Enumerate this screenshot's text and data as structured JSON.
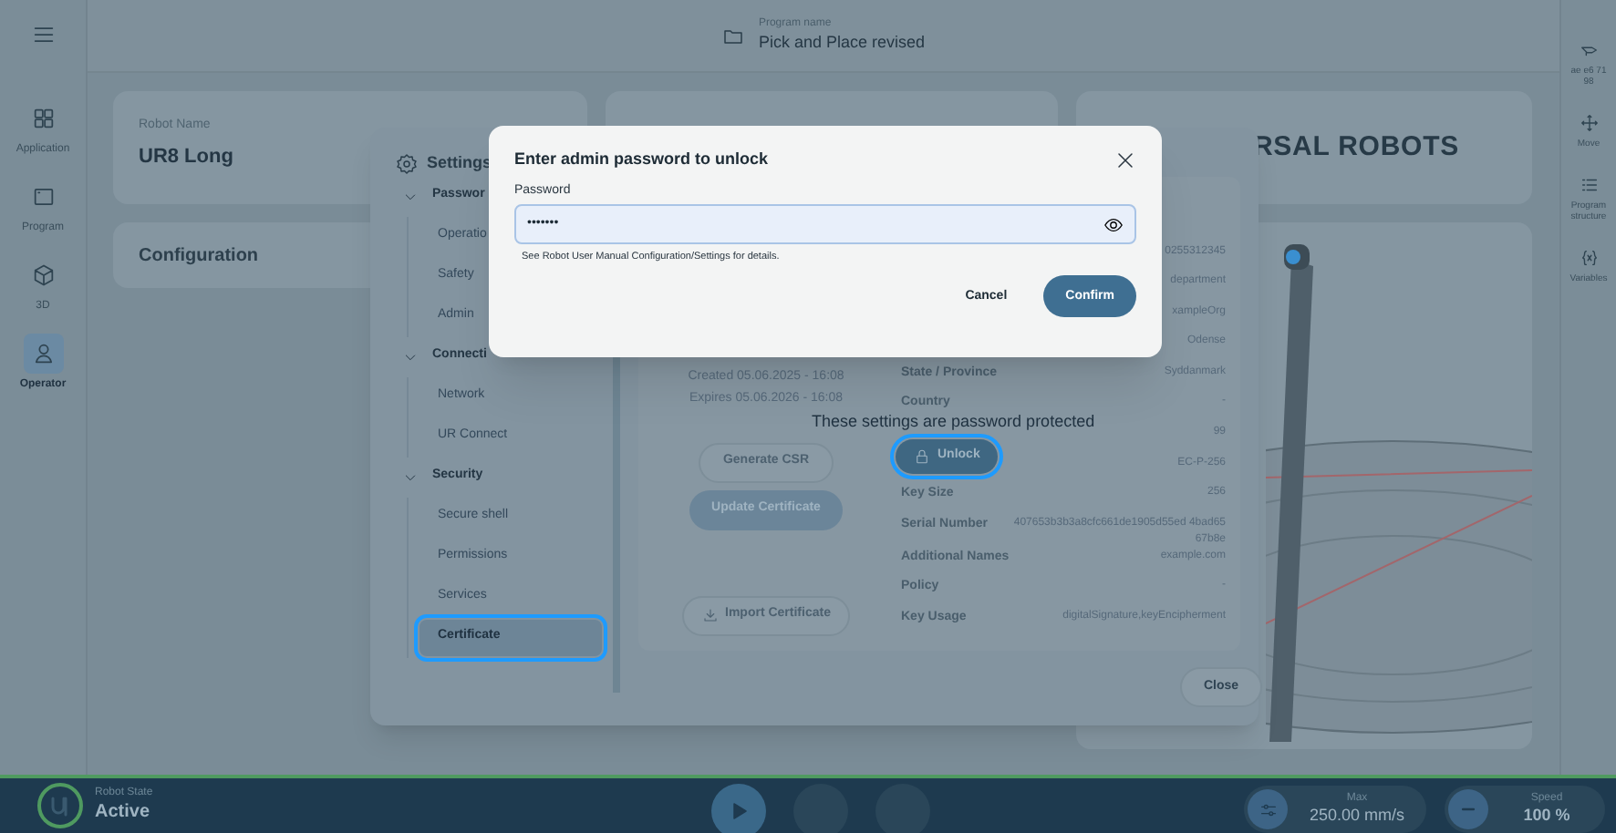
{
  "left_sidebar": {
    "items": [
      {
        "kind": "menu"
      },
      {
        "kind": "application",
        "label": "Application",
        "selected": false
      },
      {
        "kind": "program",
        "label": "Program",
        "selected": false
      },
      {
        "kind": "cube",
        "label": "3D",
        "selected": false
      },
      {
        "kind": "operator",
        "label": "Operator",
        "selected": true
      }
    ]
  },
  "top_bar": {
    "caption": "Program name",
    "program_name": "Pick and Place revised"
  },
  "robot_card": {
    "label": "Robot Name",
    "value": "UR8 Long"
  },
  "configuration_card": {
    "title": "Configuration"
  },
  "logo": {
    "text": "RSAL ROBOTS"
  },
  "right_sidebar": {
    "items": [
      {
        "kind": "tag",
        "label": "ae e6 71 98"
      },
      {
        "kind": "move",
        "label": "Move"
      },
      {
        "kind": "structure",
        "label": "Program structure"
      },
      {
        "kind": "variables",
        "label": "Variables"
      }
    ]
  },
  "status_bar": {
    "caption": "Robot State",
    "state": "Active",
    "max_caption": "Max",
    "max_value": "250.00 mm/s",
    "speed_caption": "Speed",
    "speed_value": "100 %"
  },
  "settings": {
    "title": "Settings",
    "menu": [
      {
        "label": "Passwor",
        "expanded": true,
        "children": [
          {
            "label": "Operatio",
            "selected": false
          },
          {
            "label": "Safety",
            "selected": false
          },
          {
            "label": "Admin",
            "selected": false
          }
        ]
      },
      {
        "label": "Connecti",
        "expanded": true,
        "children": [
          {
            "label": "Network",
            "selected": false
          },
          {
            "label": "UR Connect",
            "selected": false
          }
        ]
      },
      {
        "label": "Security",
        "expanded": true,
        "children": [
          {
            "label": "Secure shell",
            "selected": false
          },
          {
            "label": "Permissions",
            "selected": false
          },
          {
            "label": "Services",
            "selected": false
          },
          {
            "label": "Certificate",
            "selected": true
          }
        ]
      }
    ],
    "certificate": {
      "dates": [
        "Created 05.06.2025 - 16:08",
        "Expires 05.06.2026 - 16:08"
      ],
      "buttons": [
        {
          "kind": "outline",
          "label": "Generate CSR"
        },
        {
          "kind": "filled",
          "label": "Update Certificate"
        },
        {
          "kind": "import",
          "label": "Import Certificate"
        }
      ],
      "rows": [
        {
          "value": "0255312345"
        },
        {
          "value": "department"
        },
        {
          "value": "xampleOrg"
        },
        {
          "value": "Odense"
        },
        {
          "label": "State / Province",
          "value": "Syddanmark"
        },
        {
          "label": "Country",
          "value": "-"
        },
        {
          "value": "99"
        },
        {
          "value": "EC-P-256"
        },
        {
          "label": "Key Size",
          "value": "256"
        },
        {
          "label": "Serial Number",
          "value": "407653b3b3a8cfc661de1905d55ed 4bad6567b8e"
        },
        {
          "label": "Additional Names",
          "value": "example.com"
        },
        {
          "label": "Policy",
          "value": "-"
        },
        {
          "label": "Key Usage",
          "value": "digitalSignature,keyEncipherment"
        }
      ]
    },
    "lock_message": "These settings are password protected",
    "unlock_label": "Unlock",
    "close_label": "Close"
  },
  "password_dialog": {
    "title": "Enter admin password to unlock",
    "field_label": "Password",
    "value": "•••••••",
    "hint": "See Robot User Manual Configuration/Settings for details.",
    "buttons": [
      {
        "kind": "text",
        "label": "Cancel"
      },
      {
        "kind": "primary",
        "label": "Confirm"
      }
    ]
  }
}
